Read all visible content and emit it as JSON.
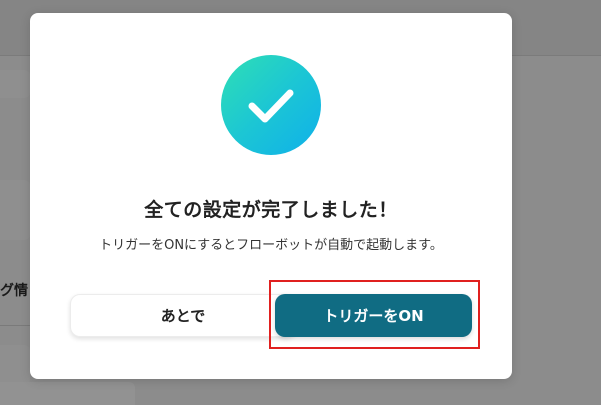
{
  "background": {
    "partial_text": "グ情"
  },
  "dialog": {
    "icon": "check-icon",
    "title": "全ての設定が完了しました！",
    "message": "トリガーをONにするとフローボットが自動で起動します。",
    "later_button": "あとで",
    "trigger_on_button": "トリガーをON"
  },
  "colors": {
    "primary_button": "#106c83",
    "check_gradient_start": "#2fdfb4",
    "check_gradient_end": "#0fb0ea",
    "highlight_border": "#e0201f"
  }
}
